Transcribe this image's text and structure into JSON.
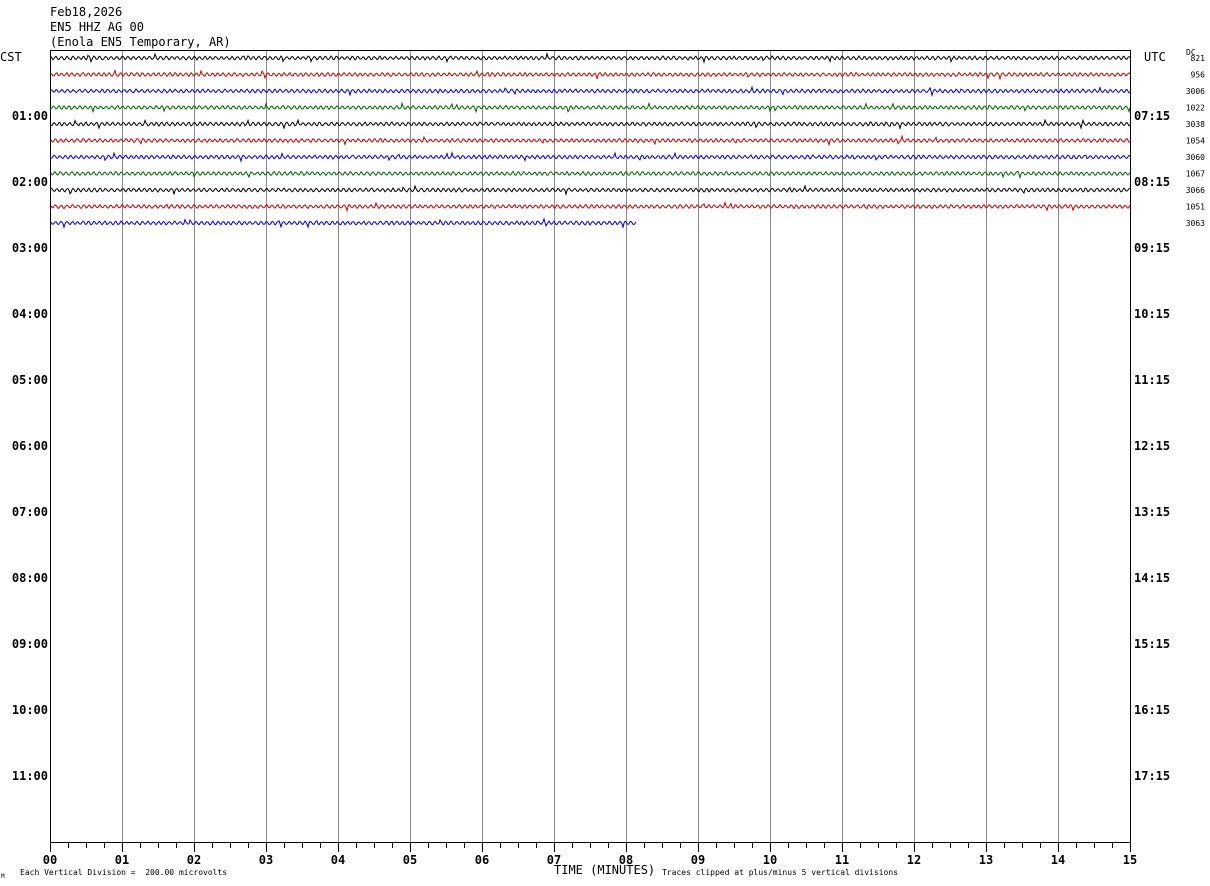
{
  "header": {
    "date": "Feb18,2026",
    "station": "EN5 HHZ AG 00",
    "location": "(Enola EN5 Temporary, AR)"
  },
  "left_tz": "CST",
  "right_tz": "UTC",
  "dc_label": "DC",
  "footer": {
    "scale_note": "Each Vertical Division =  200.00 microvolts",
    "xlabel": "TIME (MINUTES)",
    "clip_note": "Traces clipped at plus/minus 5 vertical divisions",
    "corner_mark": "M"
  },
  "chart_data": {
    "type": "line",
    "title": "",
    "xlabel": "TIME (MINUTES)",
    "x_range": [
      0,
      15
    ],
    "x_ticks": [
      "00",
      "01",
      "02",
      "03",
      "04",
      "05",
      "06",
      "07",
      "08",
      "09",
      "10",
      "11",
      "12",
      "13",
      "14",
      "15"
    ],
    "y_ticks_left": [
      "01:00",
      "02:00",
      "03:00",
      "04:00",
      "05:00",
      "06:00",
      "07:00",
      "08:00",
      "09:00",
      "10:00",
      "11:00"
    ],
    "y_ticks_right": [
      "07:15",
      "08:15",
      "09:15",
      "10:15",
      "11:15",
      "12:15",
      "13:15",
      "14:15",
      "15:15",
      "16:15",
      "17:15"
    ],
    "row_minutes": 15,
    "color_cycle": [
      "#000000",
      "#cc0000",
      "#0000cc",
      "#006600"
    ],
    "traces": [
      {
        "row": 0,
        "dc": "821",
        "end_minute": 15
      },
      {
        "row": 1,
        "dc": "956",
        "end_minute": 15
      },
      {
        "row": 2,
        "dc": "3006",
        "end_minute": 15
      },
      {
        "row": 3,
        "dc": "1022",
        "end_minute": 15
      },
      {
        "row": 4,
        "dc": "3038",
        "end_minute": 15
      },
      {
        "row": 5,
        "dc": "1054",
        "end_minute": 15
      },
      {
        "row": 6,
        "dc": "3060",
        "end_minute": 15
      },
      {
        "row": 7,
        "dc": "1067",
        "end_minute": 15
      },
      {
        "row": 8,
        "dc": "3066",
        "end_minute": 15
      },
      {
        "row": 9,
        "dc": "1051",
        "end_minute": 15
      },
      {
        "row": 10,
        "dc": "3063",
        "end_minute": 8.15
      }
    ],
    "grid": true
  }
}
